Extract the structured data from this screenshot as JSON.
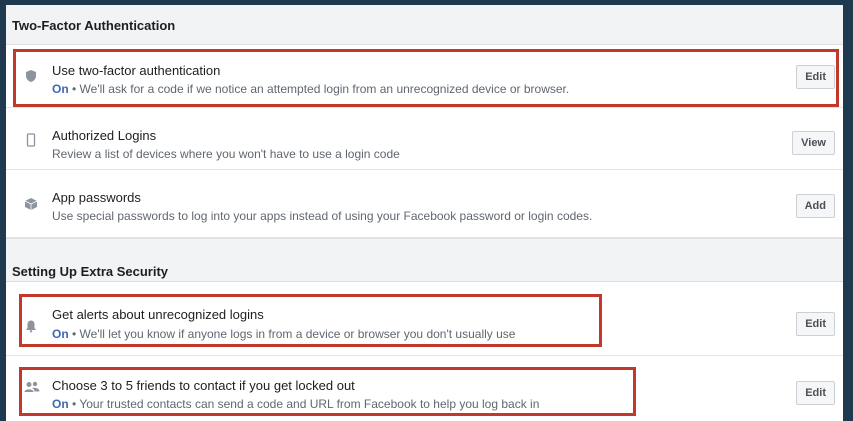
{
  "sections": [
    {
      "title": "Two-Factor Authentication",
      "rows": [
        {
          "heading": "Use two-factor authentication",
          "status": "On",
          "description": " • We'll ask for a code if we notice an attempted login from an unrecognized device or browser.",
          "button": "Edit",
          "icon": "shield-icon"
        },
        {
          "heading": "Authorized Logins",
          "description": "Review a list of devices where you won't have to use a login code",
          "button": "View",
          "icon": "phone-icon"
        },
        {
          "heading": "App passwords",
          "description": "Use special passwords to log into your apps instead of using your Facebook password or login codes.",
          "button": "Add",
          "icon": "cube-icon"
        }
      ]
    },
    {
      "title": "Setting Up Extra Security",
      "rows": [
        {
          "heading": "Get alerts about unrecognized logins",
          "status": "On",
          "description": " • We'll let you know if anyone logs in from a device or browser you don't usually use",
          "button": "Edit",
          "icon": "bell-icon"
        },
        {
          "heading": "Choose 3 to 5 friends to contact if you get locked out",
          "status": "On",
          "description": " • Your trusted contacts can send a code and URL from Facebook to help you log back in",
          "button": "Edit",
          "icon": "friends-icon"
        }
      ]
    }
  ],
  "colors": {
    "status_on": "#4267b2",
    "highlight": "#c0392b",
    "frame": "#1f3a4f"
  }
}
